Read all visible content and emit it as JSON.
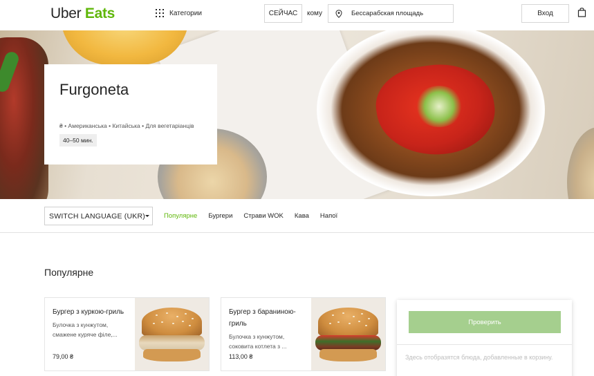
{
  "header": {
    "logo_uber": "Uber",
    "logo_eats": "Eats",
    "categories_label": "Категории",
    "now_button": "СЕЙЧАС",
    "to_label": "кому",
    "address": "Бессарабская площадь",
    "login_button": "Вход",
    "icons": [
      "grid-icon",
      "location-pin-icon",
      "shopping-bag-icon"
    ]
  },
  "restaurant": {
    "name": "Furgoneta",
    "tags": "₴ • Американська • Китайська • Для вегетаріанців",
    "eta": "40–50 мин."
  },
  "nav": {
    "language_select": "SWITCH LANGUAGE (UKR)",
    "tabs": [
      {
        "label": "Популярне",
        "active": true
      },
      {
        "label": "Бургери",
        "active": false
      },
      {
        "label": "Страви WOK",
        "active": false
      },
      {
        "label": "Кава",
        "active": false
      },
      {
        "label": "Напої",
        "active": false
      }
    ]
  },
  "section": {
    "title": "Популярне"
  },
  "items": [
    {
      "name": "Бургер з куркою-гриль",
      "description": "Булочка з кунжутом, смажене куряче філе,...",
      "price": "79,00 ₴"
    },
    {
      "name": "Бургер з бараниною-гриль",
      "description": "Булочка з кунжутом, соковита котлета з ...",
      "price": "113,00 ₴"
    }
  ],
  "cart": {
    "check_button": "Проверить",
    "empty_text": "Здесь отобразятся блюда, добавленные в корзину."
  },
  "colors": {
    "brand_green": "#5fb709",
    "check_button": "#a5cf8e"
  }
}
